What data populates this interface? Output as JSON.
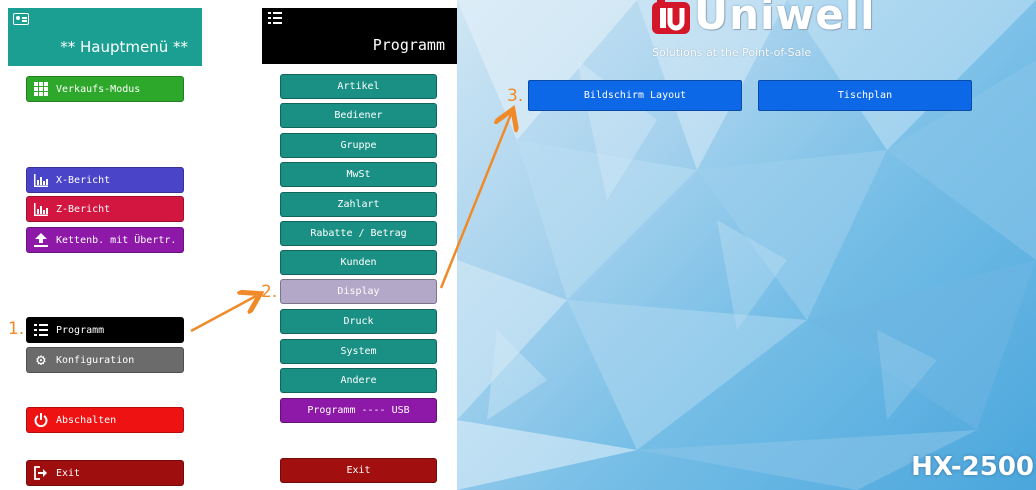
{
  "main_menu": {
    "title": "** Hauptmenü **",
    "items": [
      {
        "label": "Verkaufs-Modus",
        "icon": "grid-icon"
      },
      {
        "label": "X-Bericht",
        "icon": "bar-chart-icon"
      },
      {
        "label": "Z-Bericht",
        "icon": "bar-chart-icon"
      },
      {
        "label": "Kettenb. mit Übertr.",
        "icon": "upload-icon"
      },
      {
        "label": "Programm",
        "icon": "list-icon"
      },
      {
        "label": "Konfiguration",
        "icon": "gear-icon"
      },
      {
        "label": "Abschalten",
        "icon": "power-icon"
      },
      {
        "label": "Exit",
        "icon": "exit-icon"
      }
    ]
  },
  "program_menu": {
    "title": "Programm",
    "items": [
      {
        "label": "Artikel"
      },
      {
        "label": "Bediener"
      },
      {
        "label": "Gruppe"
      },
      {
        "label": "MwSt"
      },
      {
        "label": "Zahlart"
      },
      {
        "label": "Rabatte / Betrag"
      },
      {
        "label": "Kunden"
      },
      {
        "label": "Display"
      },
      {
        "label": "Druck"
      },
      {
        "label": "System"
      },
      {
        "label": "Andere"
      },
      {
        "label": "Programm ---- USB"
      },
      {
        "label": "Exit"
      }
    ]
  },
  "display_menu": {
    "items": [
      {
        "label": "Bildschirm Layout"
      },
      {
        "label": "Tischplan"
      }
    ]
  },
  "steps": [
    "1.",
    "2.",
    "3."
  ],
  "brand": {
    "name": "Uniwell",
    "tagline": "Solutions at the Point-of-Sale",
    "model": "HX-2500"
  },
  "colors": {
    "accent_teal": "#1a9085",
    "arrow_orange": "#f08a28",
    "selected_button_blue": "#0d68e8"
  }
}
